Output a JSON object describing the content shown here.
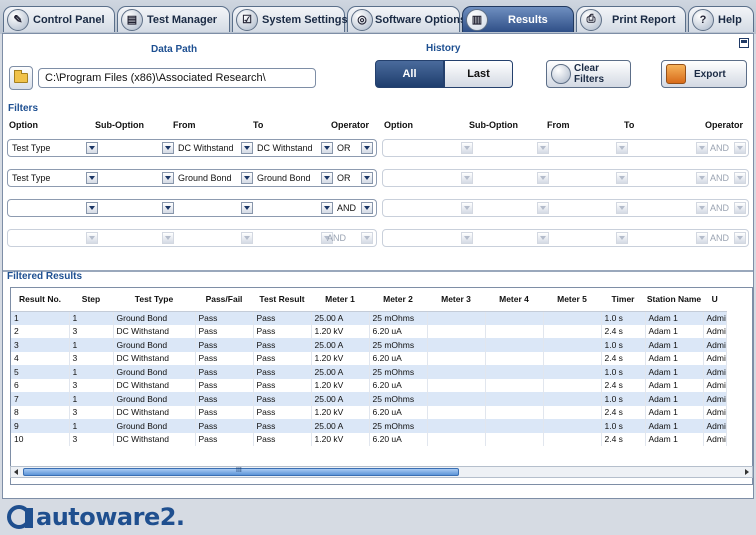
{
  "tabs": [
    {
      "label": "Control Panel",
      "icon": "compass-icon",
      "active": false
    },
    {
      "label": "Test Manager",
      "icon": "chart-icon",
      "active": false
    },
    {
      "label": "System Settings",
      "icon": "checklist-icon",
      "active": false
    },
    {
      "label": "Software Options",
      "icon": "cd-icon",
      "active": false
    },
    {
      "label": "Results",
      "icon": "books-icon",
      "active": true
    },
    {
      "label": "Print Report",
      "icon": "printer-icon",
      "active": false
    },
    {
      "label": "Help",
      "icon": "question-icon",
      "active": false
    }
  ],
  "data_path": {
    "heading": "Data Path",
    "value": "C:\\Program Files (x86)\\Associated Research\\"
  },
  "history": {
    "heading": "History",
    "all_label": "All",
    "last_label": "Last",
    "selected": "All"
  },
  "actions": {
    "clear_filters": "Clear Filters",
    "export": "Export"
  },
  "filters": {
    "heading": "Filters",
    "columns": [
      "Option",
      "Sub-Option",
      "From",
      "To",
      "Operator"
    ],
    "left_rows": [
      {
        "option": "Test Type",
        "sub_option": "",
        "from": "DC Withstand",
        "to": "DC Withstand",
        "operator": "OR",
        "enabled": true
      },
      {
        "option": "Test Type",
        "sub_option": "",
        "from": "Ground Bond",
        "to": "Ground Bond",
        "operator": "OR",
        "enabled": true
      },
      {
        "option": "",
        "sub_option": "",
        "from": "",
        "to": "",
        "operator": "AND",
        "enabled": true
      },
      {
        "option": "",
        "sub_option": "",
        "from": "",
        "to": "",
        "operator": "AND",
        "enabled": false
      }
    ],
    "right_rows": [
      {
        "operator": "AND"
      },
      {
        "operator": "AND"
      },
      {
        "operator": "AND"
      },
      {
        "operator": "AND"
      }
    ]
  },
  "results": {
    "heading": "Filtered Results",
    "columns": [
      "Result No.",
      "Step",
      "Test Type",
      "Pass/Fail",
      "Test Result",
      "Meter 1",
      "Meter 2",
      "Meter 3",
      "Meter 4",
      "Meter 5",
      "Timer",
      "Station Name",
      "U"
    ],
    "rows": [
      [
        "1",
        "1",
        "Ground Bond",
        "Pass",
        "Pass",
        "25.00 A",
        "25 mOhms",
        "",
        "",
        "",
        "1.0 s",
        "Adam 1",
        "Admi"
      ],
      [
        "2",
        "3",
        "DC Withstand",
        "Pass",
        "Pass",
        "1.20 kV",
        "6.20 uA",
        "",
        "",
        "",
        "2.4 s",
        "Adam 1",
        "Admi"
      ],
      [
        "3",
        "1",
        "Ground Bond",
        "Pass",
        "Pass",
        "25.00 A",
        "25 mOhms",
        "",
        "",
        "",
        "1.0 s",
        "Adam 1",
        "Admi"
      ],
      [
        "4",
        "3",
        "DC Withstand",
        "Pass",
        "Pass",
        "1.20 kV",
        "6.20 uA",
        "",
        "",
        "",
        "2.4 s",
        "Adam 1",
        "Admi"
      ],
      [
        "5",
        "1",
        "Ground Bond",
        "Pass",
        "Pass",
        "25.00 A",
        "25 mOhms",
        "",
        "",
        "",
        "1.0 s",
        "Adam 1",
        "Admi"
      ],
      [
        "6",
        "3",
        "DC Withstand",
        "Pass",
        "Pass",
        "1.20 kV",
        "6.20 uA",
        "",
        "",
        "",
        "2.4 s",
        "Adam 1",
        "Admi"
      ],
      [
        "7",
        "1",
        "Ground Bond",
        "Pass",
        "Pass",
        "25.00 A",
        "25 mOhms",
        "",
        "",
        "",
        "1.0 s",
        "Adam 1",
        "Admi"
      ],
      [
        "8",
        "3",
        "DC Withstand",
        "Pass",
        "Pass",
        "1.20 kV",
        "6.20 uA",
        "",
        "",
        "",
        "2.4 s",
        "Adam 1",
        "Admi"
      ],
      [
        "9",
        "1",
        "Ground Bond",
        "Pass",
        "Pass",
        "25.00 A",
        "25 mOhms",
        "",
        "",
        "",
        "1.0 s",
        "Adam 1",
        "Admi"
      ],
      [
        "10",
        "3",
        "DC Withstand",
        "Pass",
        "Pass",
        "1.20 kV",
        "6.20 uA",
        "",
        "",
        "",
        "2.4 s",
        "Adam 1",
        "Admi"
      ]
    ]
  },
  "scrollbar_grip": "III",
  "brand": {
    "logo_text": "autoware2."
  },
  "icon_glyphs": {
    "compass-icon": "✎",
    "chart-icon": "▤",
    "checklist-icon": "☑",
    "cd-icon": "◎",
    "books-icon": "▥",
    "printer-icon": "⎙",
    "question-icon": "?"
  },
  "colors": {
    "accent": "#2f4f87",
    "heading": "#1d4f91",
    "row_alt": "#dbe7f7"
  }
}
